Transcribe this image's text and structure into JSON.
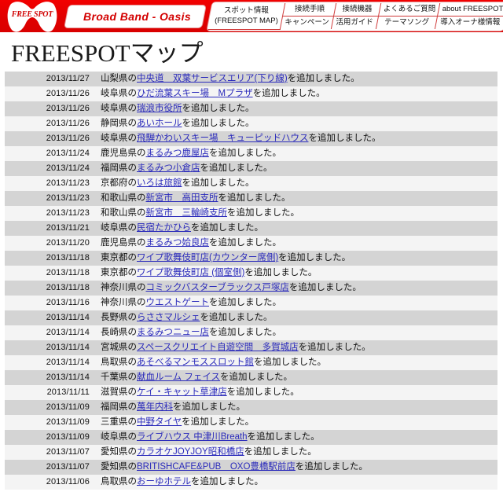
{
  "header": {
    "logo_text": "FREE SPOT",
    "tagline": "Broad Band - Oasis",
    "nav": {
      "spot_info_l1": "スポット情報",
      "spot_info_l2": "(FREESPOT MAP)",
      "connect_steps": "接続手順",
      "connect_devices": "接続機器",
      "faq": "よくあるご質問",
      "about": "about FREESPOT",
      "campaign": "キャンペーン",
      "guide": "活用ガイド",
      "theme_song": "テーマソング",
      "owner_info": "導入オーナ様情報"
    }
  },
  "page": {
    "title": "FREESPOTマップ"
  },
  "list": {
    "rows": [
      {
        "date": "2013/11/27",
        "pre": "山梨県の",
        "link": "中央道　双葉サービスエリア(下り線)",
        "post": "を追加しました。"
      },
      {
        "date": "2013/11/26",
        "pre": "岐阜県の",
        "link": "ひだ流葉スキー場　Mプラザ",
        "post": "を追加しました。"
      },
      {
        "date": "2013/11/26",
        "pre": "岐阜県の",
        "link": "瑞浪市役所",
        "post": "を追加しました。"
      },
      {
        "date": "2013/11/26",
        "pre": "静岡県の",
        "link": "あいホール",
        "post": "を追加しました。"
      },
      {
        "date": "2013/11/26",
        "pre": "岐阜県の",
        "link": "飛騨かわいスキー場　キューピッドハウス",
        "post": "を追加しました。"
      },
      {
        "date": "2013/11/24",
        "pre": "鹿児島県の",
        "link": "まるみつ鹿屋店",
        "post": "を追加しました。"
      },
      {
        "date": "2013/11/24",
        "pre": "福岡県の",
        "link": "まるみつ小倉店",
        "post": "を追加しました。"
      },
      {
        "date": "2013/11/23",
        "pre": "京都府の",
        "link": "いろは旅館",
        "post": "を追加しました。"
      },
      {
        "date": "2013/11/23",
        "pre": "和歌山県の",
        "link": "新宮市　高田支所",
        "post": "を追加しました。"
      },
      {
        "date": "2013/11/23",
        "pre": "和歌山県の",
        "link": "新宮市　三輪崎支所",
        "post": "を追加しました。"
      },
      {
        "date": "2013/11/21",
        "pre": "岐阜県の",
        "link": "民宿たかひら",
        "post": "を追加しました。"
      },
      {
        "date": "2013/11/20",
        "pre": "鹿児島県の",
        "link": "まるみつ姶良店",
        "post": "を追加しました。"
      },
      {
        "date": "2013/11/18",
        "pre": "東京都の",
        "link": "ワイプ歌舞伎町店(カウンター席側)",
        "post": "を追加しました。"
      },
      {
        "date": "2013/11/18",
        "pre": "東京都の",
        "link": "ワイプ歌舞伎町店 (個室側)",
        "post": "を追加しました。"
      },
      {
        "date": "2013/11/18",
        "pre": "神奈川県の",
        "link": "コミックバスターブラックス戸塚店",
        "post": "を追加しました。"
      },
      {
        "date": "2013/11/16",
        "pre": "神奈川県の",
        "link": "ウエストゲート",
        "post": "を追加しました。"
      },
      {
        "date": "2013/11/14",
        "pre": "長野県の",
        "link": "らささマルシェ",
        "post": "を追加しました。"
      },
      {
        "date": "2013/11/14",
        "pre": "長崎県の",
        "link": "まるみつニュー店",
        "post": "を追加しました。"
      },
      {
        "date": "2013/11/14",
        "pre": "宮城県の",
        "link": "スペースクリエイト自遊空間　多賀城店",
        "post": "を追加しました。"
      },
      {
        "date": "2013/11/14",
        "pre": "鳥取県の",
        "link": "あそべるマンモススロット館",
        "post": "を追加しました。"
      },
      {
        "date": "2013/11/14",
        "pre": "千葉県の",
        "link": "献血ルーム フェイス",
        "post": "を追加しました。"
      },
      {
        "date": "2013/11/11",
        "pre": "滋賀県の",
        "link": "ケイ・キャット草津店",
        "post": "を追加しました。"
      },
      {
        "date": "2013/11/09",
        "pre": "福岡県の",
        "link": "萬年内科",
        "post": "を追加しました。"
      },
      {
        "date": "2013/11/09",
        "pre": "三重県の",
        "link": "中野タイヤ",
        "post": "を追加しました。"
      },
      {
        "date": "2013/11/09",
        "pre": "岐阜県の",
        "link": "ライブハウス 中津川Breath",
        "post": "を追加しました。"
      },
      {
        "date": "2013/11/07",
        "pre": "愛知県の",
        "link": "カラオケJOYJOY昭和橋店",
        "post": "を追加しました。"
      },
      {
        "date": "2013/11/07",
        "pre": "愛知県の",
        "link": "BRITISHCAFE&PUB　OXO豊橋駅前店",
        "post": "を追加しました。"
      },
      {
        "date": "2013/11/06",
        "pre": "鳥取県の",
        "link": "おーゆホテル",
        "post": "を追加しました。"
      }
    ]
  }
}
